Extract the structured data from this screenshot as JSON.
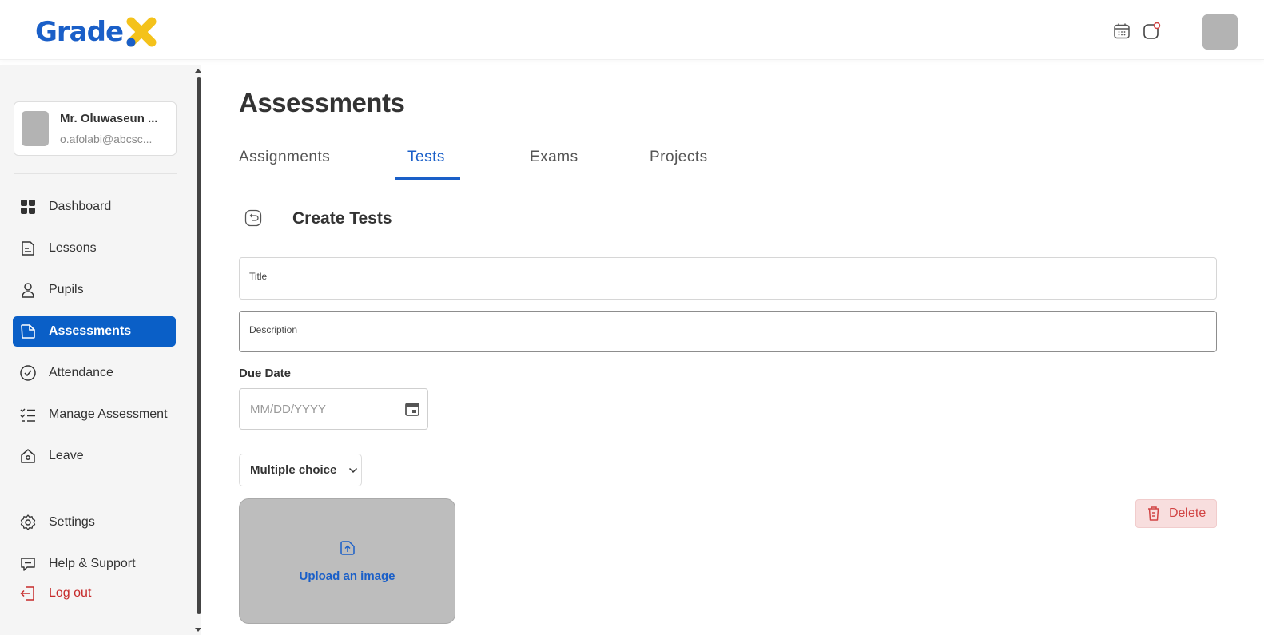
{
  "brand": {
    "name": "Grade",
    "primary": "#1a5fc8",
    "accent": "#f4c21b"
  },
  "profile": {
    "name": "Mr. Oluwaseun ...",
    "email": "o.afolabi@abcsc..."
  },
  "nav": {
    "items": [
      {
        "label": "Dashboard",
        "icon": "grid-icon"
      },
      {
        "label": "Lessons",
        "icon": "document-icon"
      },
      {
        "label": "Pupils",
        "icon": "user-icon"
      },
      {
        "label": "Assessments",
        "icon": "assessment-icon",
        "active": true
      },
      {
        "label": "Attendance",
        "icon": "check-circle-icon"
      },
      {
        "label": "Manage Assessment",
        "icon": "checklist-icon"
      },
      {
        "label": "Leave",
        "icon": "home-icon"
      }
    ],
    "settings": "Settings",
    "help": "Help & Support",
    "logout": "Log out"
  },
  "page": {
    "title": "Assessments"
  },
  "tabs": [
    {
      "label": "Assignments"
    },
    {
      "label": "Tests",
      "active": true
    },
    {
      "label": "Exams"
    },
    {
      "label": "Projects"
    }
  ],
  "form": {
    "heading": "Create Tests",
    "title_label": "Title",
    "description_label": "Description",
    "due_date_label": "Due Date",
    "due_date_placeholder": "MM/DD/YYYY",
    "question_type": "Multiple choice",
    "upload_label": "Upload an image",
    "delete_label": "Delete"
  },
  "colors": {
    "active_nav": "#0a5fc7",
    "danger": "#d14343",
    "danger_bg": "#f8dede"
  }
}
